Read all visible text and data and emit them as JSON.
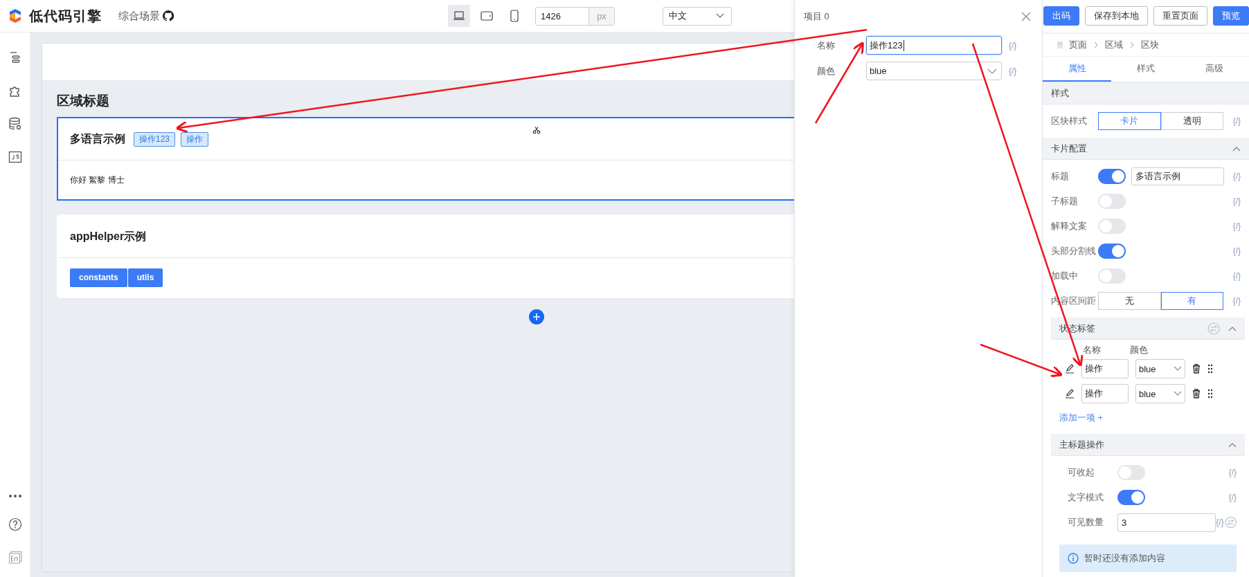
{
  "brand": {
    "name": "低代码引擎",
    "scene": "综合场景"
  },
  "devices": [
    {
      "kind": "desktop",
      "selected": true
    },
    {
      "kind": "tablet",
      "selected": false
    },
    {
      "kind": "phone",
      "selected": false
    }
  ],
  "width_field": {
    "value": "1426",
    "unit": "px"
  },
  "language_select": {
    "value": "中文"
  },
  "canvas": {
    "section_title": "区域标题",
    "cards": [
      {
        "title": "多语言示例",
        "selected": true,
        "tags": [
          "操作123",
          "操作"
        ],
        "body_text": "你好 絮黎 博士"
      },
      {
        "title": "appHelper示例",
        "selected": false,
        "buttons": [
          "constants",
          "utils"
        ]
      }
    ]
  },
  "drawer": {
    "title": "项目 0",
    "fields": [
      {
        "kind": "input",
        "label": "名称",
        "value": "操作123",
        "focused": true,
        "binding": "{/}"
      },
      {
        "kind": "select",
        "label": "颜色",
        "value": "blue",
        "focused": false,
        "binding": "{/}"
      }
    ]
  },
  "actions": [
    {
      "label": "出码",
      "primary": true
    },
    {
      "label": "保存到本地",
      "primary": false
    },
    {
      "label": "重置页面",
      "primary": false
    },
    {
      "label": "预览",
      "primary": true
    }
  ],
  "breadcrumb": [
    "页面",
    "区域",
    "区块"
  ],
  "tabs": [
    {
      "label": "属性",
      "selected": true
    },
    {
      "label": "样式",
      "selected": false
    },
    {
      "label": "高级",
      "selected": false
    }
  ],
  "sections": [
    {
      "title": "样式",
      "collapsible": false,
      "inset": false,
      "rows": [
        {
          "kind": "segmented",
          "label": "区块样式",
          "binding": "{/}",
          "options": [
            {
              "label": "卡片",
              "selected": true
            },
            {
              "label": "透明",
              "selected": false
            }
          ]
        }
      ]
    },
    {
      "title": "卡片配置",
      "collapsible": true,
      "inset": false,
      "rows": [
        {
          "kind": "switch",
          "label": "标题",
          "on": true,
          "value": "多语言示例",
          "binding": "{/}"
        },
        {
          "kind": "switch",
          "label": "子标题",
          "on": false,
          "binding": "{/}"
        },
        {
          "kind": "switch",
          "label": "解释文案",
          "on": false,
          "binding": "{/}"
        },
        {
          "kind": "switch",
          "label": "头部分割线",
          "on": true,
          "binding": "{/}"
        },
        {
          "kind": "switch",
          "label": "加载中",
          "on": false,
          "binding": "{/}"
        },
        {
          "kind": "segmented",
          "label": "内容区间距",
          "binding": "{/}",
          "options": [
            {
              "label": "无",
              "selected": false
            },
            {
              "label": "有",
              "selected": true
            }
          ]
        }
      ]
    },
    {
      "title": "状态标签",
      "collapsible": true,
      "inset": true,
      "variable_toggle": true,
      "list": {
        "columns": [
          "名称",
          "颜色"
        ],
        "items": [
          {
            "name": "操作",
            "color_option": "blue"
          },
          {
            "name": "操作",
            "color_option": "blue"
          }
        ],
        "add_label": "添加一项 +"
      }
    },
    {
      "title": "主标题操作",
      "collapsible": true,
      "inset": true,
      "rows": [
        {
          "kind": "switch",
          "label": "可收起",
          "on": false,
          "binding": "{/}"
        },
        {
          "kind": "switch",
          "label": "文字模式",
          "on": true,
          "binding": "{/}"
        },
        {
          "kind": "input",
          "label": "可见数量",
          "value": "3",
          "binding": "{/}",
          "variable_toggle": true
        }
      ],
      "notice": "暂时还没有添加内容"
    }
  ]
}
